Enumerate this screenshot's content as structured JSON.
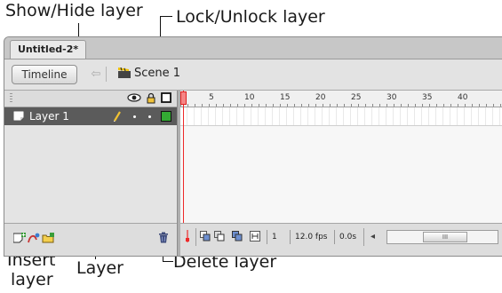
{
  "callouts": {
    "show_hide": "Show/Hide layer",
    "lock_unlock": "Lock/Unlock layer",
    "insert_layer_line1": "Insert",
    "insert_layer_line2": "layer",
    "layer": "Layer",
    "delete_layer": "Delete layer"
  },
  "document": {
    "tab_title": "Untitled-2*"
  },
  "scene_bar": {
    "timeline_button": "Timeline",
    "back_glyph": "⇦",
    "scene_label": "Scene 1"
  },
  "layers": [
    {
      "name": "Layer 1",
      "color": "#33aa33",
      "selected": true
    }
  ],
  "ruler": {
    "ticks": [
      "5",
      "10",
      "15",
      "20",
      "25",
      "30",
      "35",
      "40"
    ]
  },
  "status": {
    "current_frame": "1",
    "fps": "12.0 fps",
    "time": "0.0s",
    "scroll_glyph": "III",
    "left_arrow": "◂"
  },
  "colors": {
    "playhead": "#ee2a2a",
    "selected_layer_bg": "#5b5b5b",
    "layer_outline": "#33aa33"
  }
}
